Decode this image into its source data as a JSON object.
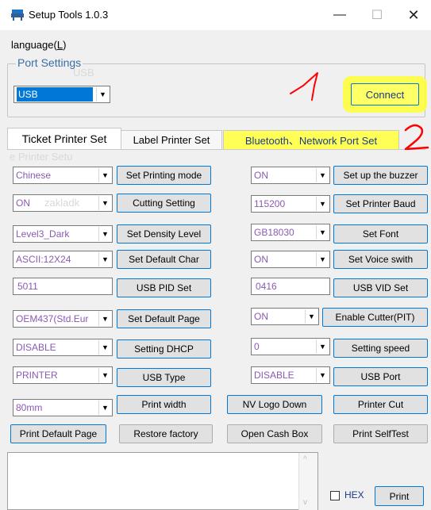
{
  "window": {
    "title": "Setup Tools 1.0.3",
    "minimize_glyph": "—",
    "maximize_glyph": "☐",
    "close_glyph": "✕"
  },
  "menu": {
    "language_prefix": "language(",
    "language_key": "L",
    "language_suffix": ")"
  },
  "port_settings": {
    "legend": "Port Settings",
    "port": "USB",
    "connect_label": "Connect"
  },
  "annotations": {
    "one": "1",
    "two": "2",
    "color": "#ff0000"
  },
  "tabs": [
    {
      "label": "Ticket Printer Set",
      "active": true
    },
    {
      "label": "Label Printer Set",
      "active": false
    },
    {
      "label": "Bluetooth、Network Port Set",
      "active": false
    }
  ],
  "ghost_text": {
    "tab": "e Printer Setu",
    "row": "zakladk",
    "group": "USB"
  },
  "left_rows": [
    {
      "value": "Chinese",
      "button": "Set Printing mode",
      "kind": "select"
    },
    {
      "value": "ON",
      "button": "Cutting Setting",
      "kind": "select"
    },
    {
      "value": "Level3_Dark",
      "button": "Set Density Level",
      "kind": "select"
    },
    {
      "value": "ASCII:12X24",
      "button": "Set Default Char",
      "kind": "select"
    },
    {
      "value": "5011",
      "button": "USB PID Set",
      "kind": "input"
    },
    {
      "value": "OEM437(Std.Eur",
      "button": "Set Default Page",
      "kind": "select"
    },
    {
      "value": "DISABLE",
      "button": "Setting DHCP",
      "kind": "select"
    },
    {
      "value": "PRINTER",
      "button": "USB Type",
      "kind": "select"
    },
    {
      "value": "80mm",
      "button": "Print width",
      "kind": "select"
    }
  ],
  "right_rows": [
    {
      "value": "ON",
      "button": "Set  up the buzzer",
      "kind": "select"
    },
    {
      "value": "115200",
      "button": "Set Printer Baud",
      "kind": "select"
    },
    {
      "value": "GB18030",
      "button": "Set Font",
      "kind": "select"
    },
    {
      "value": "ON",
      "button": "Set Voice swith",
      "kind": "select"
    },
    {
      "value": "0416",
      "button": "USB VID Set",
      "kind": "input"
    },
    {
      "value": "ON",
      "button": "Enable Cutter(PIT)",
      "kind": "select"
    },
    {
      "value": "0",
      "button": "Setting speed",
      "kind": "select"
    },
    {
      "value": "DISABLE",
      "button": "USB Port",
      "kind": "select"
    }
  ],
  "extra_buttons": {
    "nv_logo": "NV Logo Down",
    "printer_cut": "Printer Cut",
    "print_default_page": "Print Default Page",
    "restore_factory": "Restore factory",
    "open_cash_box": "Open Cash Box",
    "print_selftest": "Print SelfTest"
  },
  "bottom": {
    "hex_label": "HEX",
    "print_label": "Print"
  }
}
